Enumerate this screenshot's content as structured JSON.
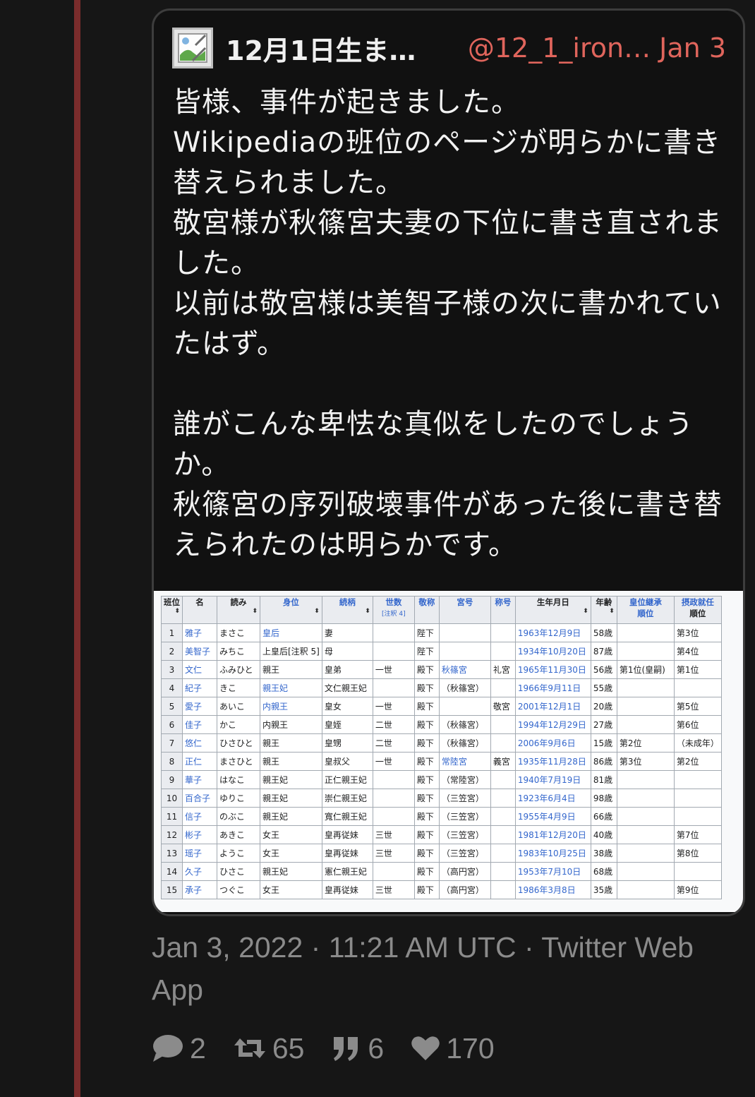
{
  "quote": {
    "author_name": "12月1日生ま…",
    "handle_and_time": "@12_1_iron… Jan 3",
    "text": "皆様、事件が起きました。\nWikipediaの班位のページが明らかに書き替えられました。\n敬宮様が秋篠宮夫妻の下位に書き直されました。\n以前は敬宮様は美智子様の次に書かれていたはず。\n\n誰がこんな卑怯な真似をしたのでしょうか。\n秋篠宮の序列破壊事件があった後に書き替えられたのは明らかです。"
  },
  "table": {
    "headers": [
      "班位",
      "名",
      "読み",
      "身位",
      "続柄",
      "世数",
      "[注釈 4]",
      "敬称",
      "宮号",
      "称号",
      "生年月日",
      "年齢",
      "皇位継承",
      "順位",
      "摂政就任",
      "順位"
    ],
    "rows": [
      [
        "1",
        "雅子",
        "まさこ",
        "皇后",
        "妻",
        "",
        "陛下",
        "",
        "",
        "1963年12月9日",
        "58歳",
        "",
        "第3位"
      ],
      [
        "2",
        "美智子",
        "みちこ",
        "上皇后[注釈 5]",
        "母",
        "",
        "陛下",
        "",
        "",
        "1934年10月20日",
        "87歳",
        "",
        "第4位"
      ],
      [
        "3",
        "文仁",
        "ふみひと",
        "親王",
        "皇弟",
        "一世",
        "殿下",
        "秋篠宮",
        "礼宮",
        "1965年11月30日",
        "56歳",
        "第1位(皇嗣)",
        "第1位"
      ],
      [
        "4",
        "紀子",
        "きこ",
        "親王妃",
        "文仁親王妃",
        "",
        "殿下",
        "（秋篠宮）",
        "",
        "1966年9月11日",
        "55歳",
        "",
        ""
      ],
      [
        "5",
        "愛子",
        "あいこ",
        "内親王",
        "皇女",
        "一世",
        "殿下",
        "",
        "敬宮",
        "2001年12月1日",
        "20歳",
        "",
        "第5位"
      ],
      [
        "6",
        "佳子",
        "かこ",
        "内親王",
        "皇姪",
        "二世",
        "殿下",
        "（秋篠宮）",
        "",
        "1994年12月29日",
        "27歳",
        "",
        "第6位"
      ],
      [
        "7",
        "悠仁",
        "ひさひと",
        "親王",
        "皇甥",
        "二世",
        "殿下",
        "（秋篠宮）",
        "",
        "2006年9月6日",
        "15歳",
        "第2位",
        "（未成年）"
      ],
      [
        "8",
        "正仁",
        "まさひと",
        "親王",
        "皇叔父",
        "一世",
        "殿下",
        "常陸宮",
        "義宮",
        "1935年11月28日",
        "86歳",
        "第3位",
        "第2位"
      ],
      [
        "9",
        "華子",
        "はなこ",
        "親王妃",
        "正仁親王妃",
        "",
        "殿下",
        "（常陸宮）",
        "",
        "1940年7月19日",
        "81歳",
        "",
        ""
      ],
      [
        "10",
        "百合子",
        "ゆりこ",
        "親王妃",
        "崇仁親王妃",
        "",
        "殿下",
        "（三笠宮）",
        "",
        "1923年6月4日",
        "98歳",
        "",
        ""
      ],
      [
        "11",
        "信子",
        "のぶこ",
        "親王妃",
        "寬仁親王妃",
        "",
        "殿下",
        "（三笠宮）",
        "",
        "1955年4月9日",
        "66歳",
        "",
        ""
      ],
      [
        "12",
        "彬子",
        "あきこ",
        "女王",
        "皇再従妹",
        "三世",
        "殿下",
        "（三笠宮）",
        "",
        "1981年12月20日",
        "40歳",
        "",
        "第7位"
      ],
      [
        "13",
        "瑶子",
        "ようこ",
        "女王",
        "皇再従妹",
        "三世",
        "殿下",
        "（三笠宮）",
        "",
        "1983年10月25日",
        "38歳",
        "",
        "第8位"
      ],
      [
        "14",
        "久子",
        "ひさこ",
        "親王妃",
        "憲仁親王妃",
        "",
        "殿下",
        "（高円宮）",
        "",
        "1953年7月10日",
        "68歳",
        "",
        ""
      ],
      [
        "15",
        "承子",
        "つぐこ",
        "女王",
        "皇再従妹",
        "三世",
        "殿下",
        "（高円宮）",
        "",
        "1986年3月8日",
        "35歳",
        "",
        "第9位"
      ]
    ]
  },
  "meta": {
    "timestamp": "Jan 3, 2022 · 11:21 AM UTC · Twitter Web App"
  },
  "stats": {
    "replies": "2",
    "retweets": "65",
    "quotes": "6",
    "likes": "170"
  },
  "icons": {
    "reply": "comment-bubble-icon",
    "retweet": "retweet-icon",
    "quote": "quote-marks-icon",
    "like": "heart-icon",
    "avatar": "broken-image-icon"
  },
  "colors": {
    "background": "#161616",
    "thread_line": "#7a2c2c",
    "handle": "#e0655c",
    "muted": "#8b8b8b",
    "link": "#3366cc"
  }
}
